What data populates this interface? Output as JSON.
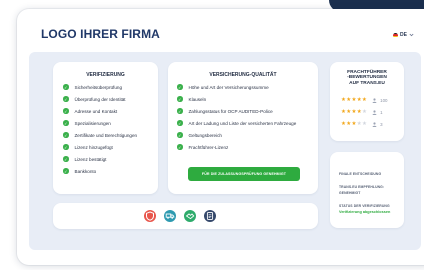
{
  "header": {
    "logo_text": "LOGO IHRER FIRMA",
    "language": {
      "code": "DE",
      "chevron": "chevron-down-icon"
    }
  },
  "verification": {
    "title": "VERIFIZIERUNG",
    "items": [
      "Sicherheitsüberprüfung",
      "Überprüfung der Identität",
      "Adresse und Kontakt",
      "Spezialisierungen",
      "Zertifikate und Berechtigungen",
      "Lizenz hinzugefügt",
      "Lizenz bestätigt",
      "Bankkonto"
    ]
  },
  "insurance": {
    "title": "VERSICHERUNG-QUALITÄT",
    "items": [
      "Höhe und Art der Versicherungssumme",
      "Klauseln",
      "Zahlungsstatus für OCP AUDITED-Police",
      "Art der Ladung und Liste der versicherten Fahrzeuge",
      "Geltungsbereich",
      "Frachtführer-Lizenz"
    ],
    "button_label": "FÜR DIE ZULASSUNGSPRÜFUNG GENEHMIGT"
  },
  "ratings": {
    "title_lines": [
      "FRACHTFÜHRER",
      "-BEWERTUNGEN",
      "AUF TRANS.EU"
    ],
    "rows": [
      {
        "stars": 5,
        "count": "100"
      },
      {
        "stars": 4,
        "count": "1"
      },
      {
        "stars": 3,
        "count": "3"
      }
    ]
  },
  "status": {
    "final_decision_label": "FINALE ENTSCHEIDUNG",
    "transeu_recommendation_label": "TRANS.EU EMPFEHLUNG:",
    "transeu_recommendation_value": "GENEHMIGT",
    "verification_status_label": "STATUS DER VERIFIZIERUNG",
    "verification_status_value": "Verifizierung abgeschlossen"
  },
  "badges": [
    {
      "icon": "shield-icon",
      "color": "#e8564c"
    },
    {
      "icon": "truck-icon",
      "color": "#2e9ab0"
    },
    {
      "icon": "handshake-icon",
      "color": "#2eab6b"
    },
    {
      "icon": "document-icon",
      "color": "#35486b"
    }
  ],
  "colors": {
    "brand_navy": "#203868",
    "success_green": "#2eab3f",
    "star": "#f2a81d",
    "panel_bg": "#e8edf6"
  }
}
